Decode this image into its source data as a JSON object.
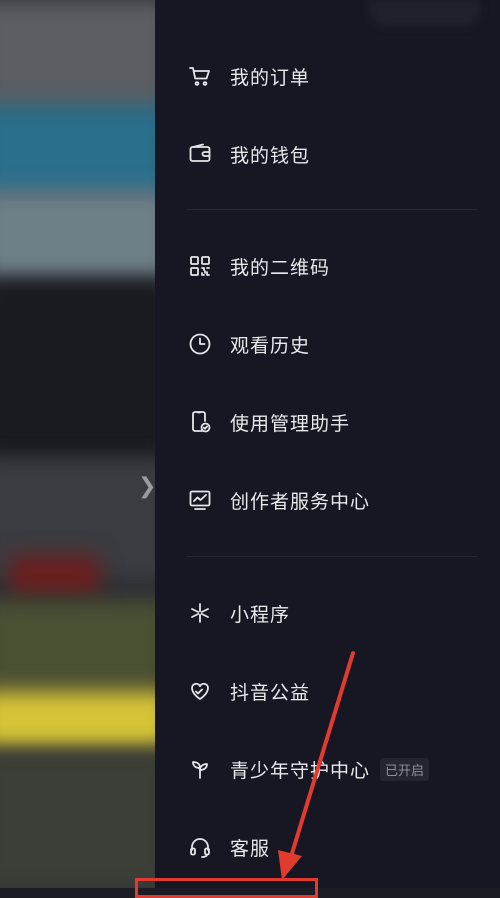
{
  "menu": {
    "items": [
      {
        "label": "我的订单",
        "icon": "cart-icon"
      },
      {
        "label": "我的钱包",
        "icon": "wallet-icon"
      },
      {
        "label": "我的二维码",
        "icon": "qr-code-icon"
      },
      {
        "label": "观看历史",
        "icon": "clock-icon"
      },
      {
        "label": "使用管理助手",
        "icon": "phone-check-icon"
      },
      {
        "label": "创作者服务中心",
        "icon": "chart-monitor-icon"
      },
      {
        "label": "小程序",
        "icon": "mini-program-icon"
      },
      {
        "label": "抖音公益",
        "icon": "heart-hands-icon"
      },
      {
        "label": "青少年守护中心",
        "icon": "sprout-icon",
        "badge": "已开启"
      },
      {
        "label": "客服",
        "icon": "headset-icon"
      }
    ]
  },
  "annotation": {
    "color": "#e23a2f"
  },
  "colors": {
    "drawer_bg": "#161722",
    "text": "#e9e9ec",
    "divider": "#262733"
  }
}
